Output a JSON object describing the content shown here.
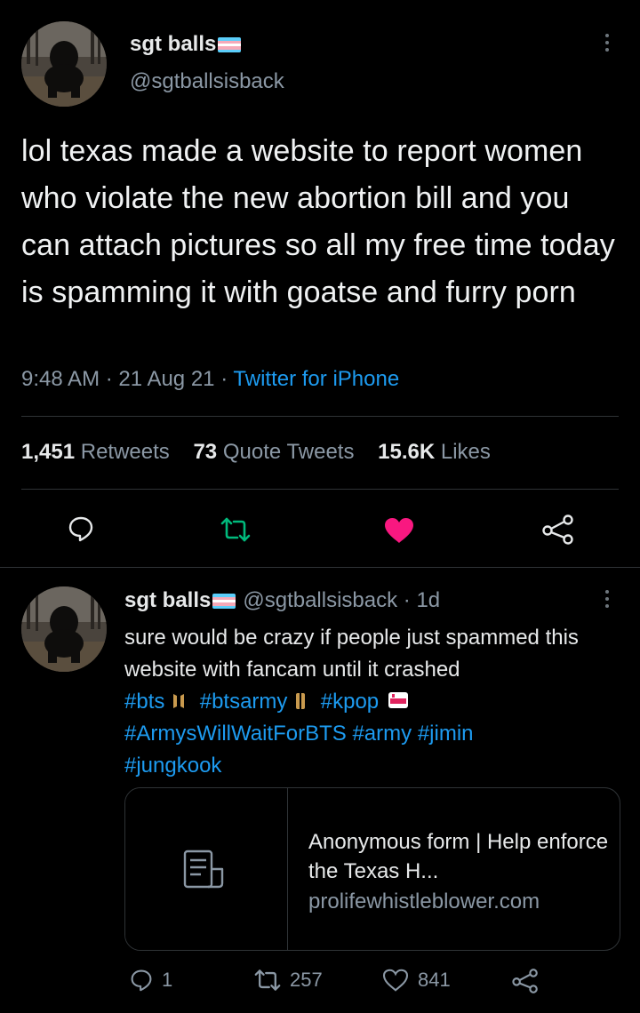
{
  "main_tweet": {
    "display_name": "sgt balls",
    "handle": "@sgtballsisback",
    "text": "lol texas made a website to report women who violate the new abortion bill and you can attach pictures so all my free time today is spamming it with goatse and furry porn",
    "time": "9:48 AM",
    "date": "21 Aug 21",
    "source": "Twitter for iPhone",
    "retweets_count": "1,451",
    "retweets_label": "Retweets",
    "quotes_count": "73",
    "quotes_label": "Quote Tweets",
    "likes_count": "15.6K",
    "likes_label": "Likes",
    "actions": [
      "reply-icon",
      "retweet-icon",
      "heart-icon",
      "share-icon"
    ],
    "like_color": "#f91880",
    "retweet_color": "#00ba7c"
  },
  "reply_tweet": {
    "display_name": "sgt balls",
    "handle": "@sgtballsisback",
    "age": "1d",
    "text_plain": "sure would be crazy if people just spammed this website with fancam until it crashed",
    "tag_bts": "#bts",
    "tag_btsarmy": "#btsarmy",
    "tag_kpop": "#kpop",
    "tag_armys": "#ArmysWillWaitForBTS",
    "tag_army": "#army",
    "tag_jimin": "#jimin",
    "tag_jungkook": "#jungkook",
    "card": {
      "title": "Anonymous form | Help enforce the Texas H...",
      "domain": "prolifewhistleblower.com",
      "icon": "document-icon"
    },
    "reply_count": "1",
    "retweet_count": "257",
    "like_count": "841"
  },
  "colors": {
    "background": "#000000",
    "text": "#e7e9ea",
    "secondary": "#8b98a5",
    "link": "#1d9bf0",
    "divider": "#2f3336"
  }
}
